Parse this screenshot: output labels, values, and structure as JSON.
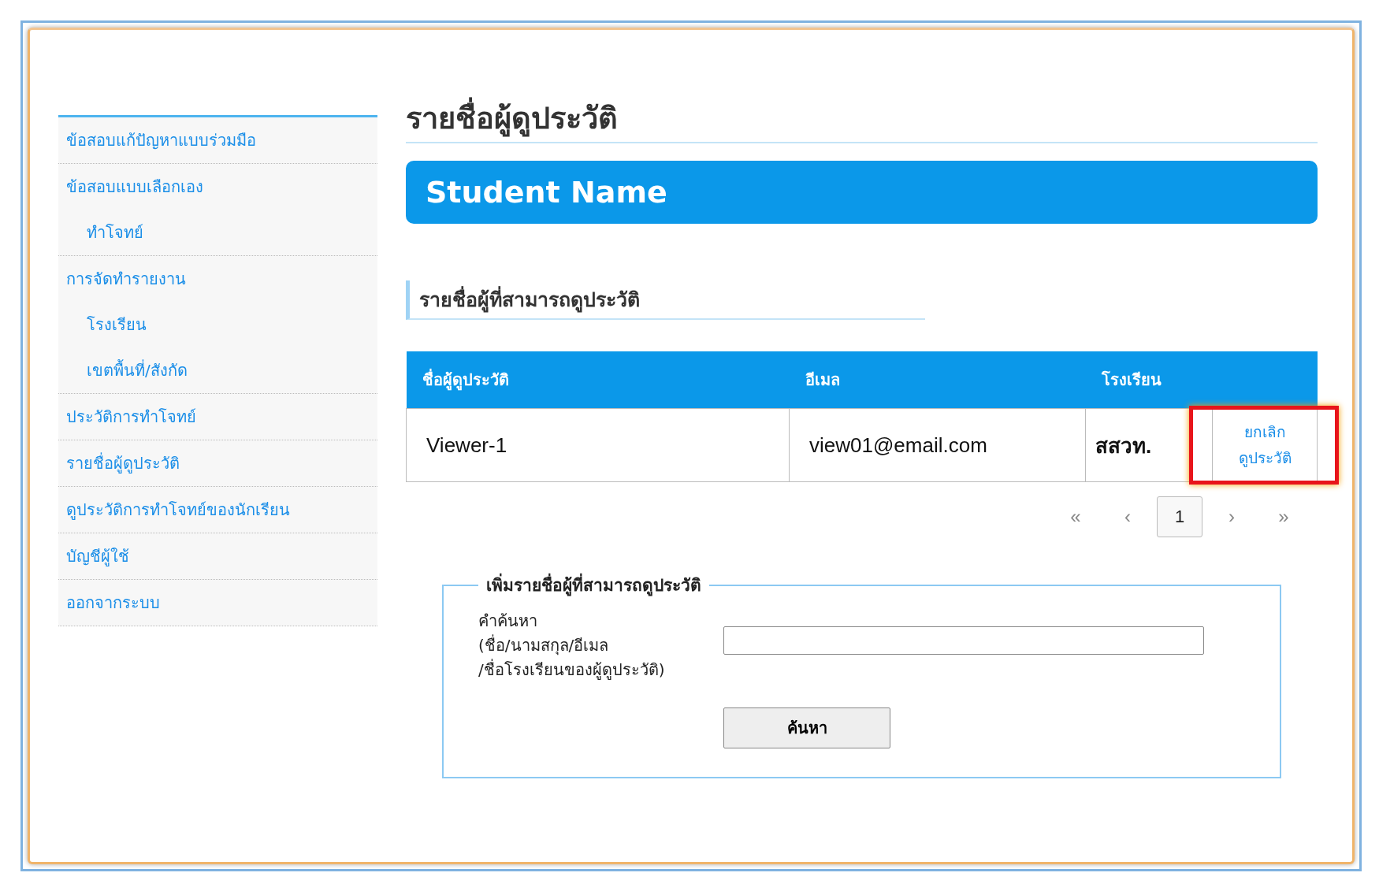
{
  "sidebar": {
    "items": [
      {
        "label": "ข้อสอบแก้ปัญหาแบบร่วมมือ"
      },
      {
        "label": "ข้อสอบแบบเลือกเอง",
        "children": [
          {
            "label": "ทำโจทย์"
          }
        ]
      },
      {
        "label": "การจัดทำรายงาน",
        "children": [
          {
            "label": "โรงเรียน"
          },
          {
            "label": "เขตพื้นที่/สังกัด"
          }
        ]
      },
      {
        "label": "ประวัติการทำโจทย์"
      },
      {
        "label": "รายชื่อผู้ดูประวัติ"
      },
      {
        "label": "ดูประวัติการทำโจทย์ของนักเรียน"
      },
      {
        "label": "บัญชีผู้ใช้"
      },
      {
        "label": "ออกจากระบบ"
      }
    ]
  },
  "page_title": "รายชื่อผู้ดูประวัติ",
  "banner": "Student Name",
  "section_title": "รายชื่อผู้ที่สามารถดูประวัติ",
  "table": {
    "columns": [
      "ชื่อผู้ดูประวัติ",
      "อีเมล",
      "โรงเรียน"
    ],
    "rows": [
      {
        "name": "Viewer-1",
        "email": "view01@email.com",
        "school": "สสวท.",
        "action_line_1": "ยกเลิก",
        "action_line_2": "ดูประวัติ",
        "highlighted": true
      }
    ]
  },
  "pagination": [
    {
      "label": "«",
      "selected": false
    },
    {
      "label": "‹",
      "selected": false
    },
    {
      "label": "1",
      "selected": true
    },
    {
      "label": "›",
      "selected": false
    },
    {
      "label": "»",
      "selected": false
    }
  ],
  "add_form": {
    "legend": "เพิ่มรายชื่อผู้ที่สามารถดูประวัติ",
    "field_label_lines": [
      "คำค้นหา",
      "(ชื่อ/นามสกุล/อีเมล",
      "/ชื่อโรงเรียนของผู้ดูประวัติ)"
    ],
    "button": "ค้นหา"
  }
}
